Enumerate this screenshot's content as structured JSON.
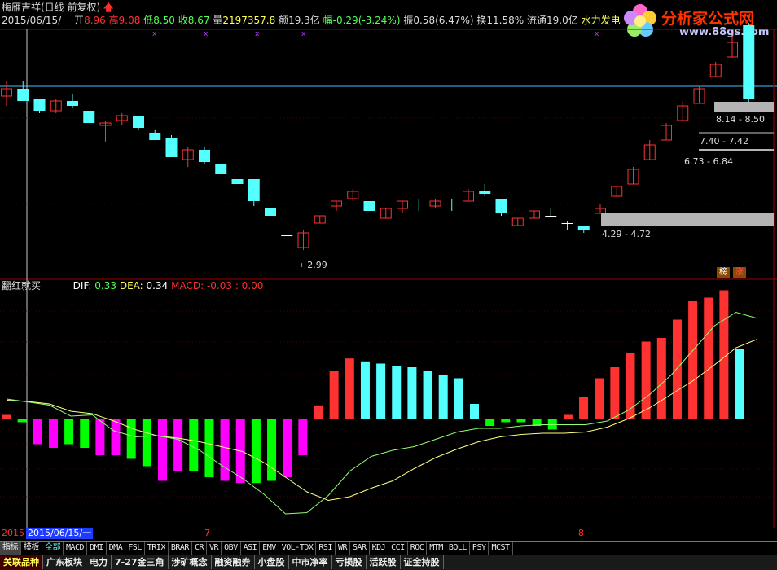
{
  "header": {
    "title": "梅雁吉祥(日线 前复权)",
    "date": "2015/06/15/一",
    "open_label": "开",
    "open": "8.96",
    "high_label": "高",
    "high": "9.08",
    "low_label": "低",
    "low": "8.50",
    "close_label": "收",
    "close": "8.67",
    "volume_label": "量",
    "volume": "2197357.8",
    "amount_label": "额",
    "amount": "19.3亿",
    "change_label": "幅",
    "change": "-0.29(-3.24%)",
    "amplitude_label": "振",
    "amplitude": "0.58(6.47%)",
    "turnover_label": "换",
    "turnover": "11.58%",
    "float_label": "流通",
    "float": "19.0亿",
    "sector": "水力发电"
  },
  "logo": {
    "name": "分析家公式网",
    "url": "www.88gs.com"
  },
  "price_panel": {
    "low_marker": "2.99",
    "zones": [
      "8.14 - 8.50",
      "7.40 - 7.42",
      "6.73 - 6.84",
      "4.29 - 4.72"
    ],
    "rank_badge": "榜",
    "rise_badge": "涨"
  },
  "indicator": {
    "name": "翻红就买",
    "dif_label": "DIF:",
    "dif": "0.33",
    "dea_label": "DEA:",
    "dea": "0.34",
    "macd_label": "MACD:",
    "macd": "-0.03",
    "extra": ": 0.00"
  },
  "date_axis": {
    "year_stub": "2015",
    "cursor_date": "2015/06/15/一",
    "month_7": "7",
    "month_8": "8"
  },
  "tabs_indicator": [
    "指标",
    "模板",
    "全部",
    "MACD",
    "DMI",
    "DMA",
    "FSL",
    "TRIX",
    "BRAR",
    "CR",
    "VR",
    "OBV",
    "ASI",
    "EMV",
    "VOL-TDX",
    "RSI",
    "WR",
    "SAR",
    "KDJ",
    "CCI",
    "ROC",
    "MTM",
    "BOLL",
    "PSY",
    "MCST"
  ],
  "tabs_sector": [
    "关联品种",
    "广东板块",
    "电力",
    "7-27金三角",
    "涉矿概念",
    "融资融券",
    "小盘股",
    "中市净率",
    "亏损股",
    "活跃股",
    "证金持股"
  ],
  "colors": {
    "up": "#ff3232",
    "down": "#54ffff",
    "dif": "#ffffff",
    "dea": "#ffff00",
    "macd_neg_a": "#00ff00",
    "macd_neg_b": "#ff00ff"
  },
  "chart_data": {
    "type": "candlestick",
    "candles": [
      {
        "o": 4.0,
        "h": 4.6,
        "l": 3.6,
        "c": 4.3
      },
      {
        "o": 4.3,
        "h": 4.6,
        "l": 4.0,
        "c": 3.8
      },
      {
        "o": 3.9,
        "h": 3.9,
        "l": 3.3,
        "c": 3.4
      },
      {
        "o": 3.4,
        "h": 3.9,
        "l": 3.3,
        "c": 3.8
      },
      {
        "o": 3.8,
        "h": 4.1,
        "l": 3.5,
        "c": 3.6
      },
      {
        "o": 3.4,
        "h": 3.4,
        "l": 2.9,
        "c": 2.9
      },
      {
        "o": 2.8,
        "h": 3.0,
        "l": 2.1,
        "c": 2.9
      },
      {
        "o": 3.0,
        "h": 3.3,
        "l": 2.8,
        "c": 3.2
      },
      {
        "o": 3.2,
        "h": 3.2,
        "l": 2.6,
        "c": 2.7
      },
      {
        "o": 2.5,
        "h": 2.6,
        "l": 2.2,
        "c": 2.2
      },
      {
        "o": 2.3,
        "h": 2.4,
        "l": 1.5,
        "c": 1.5
      },
      {
        "o": 1.4,
        "h": 1.9,
        "l": 1.1,
        "c": 1.8
      },
      {
        "o": 1.8,
        "h": 1.9,
        "l": 1.2,
        "c": 1.3
      },
      {
        "o": 1.2,
        "h": 1.2,
        "l": 0.8,
        "c": 0.8
      },
      {
        "o": 0.6,
        "h": 0.6,
        "l": 0.4,
        "c": 0.4
      },
      {
        "o": 0.6,
        "h": 0.6,
        "l": -0.5,
        "c": -0.3
      },
      {
        "o": -0.6,
        "h": -0.6,
        "l": -0.9,
        "c": -0.9
      },
      {
        "o": -1.7,
        "h": -1.7,
        "l": -1.7,
        "c": -1.7
      },
      {
        "o": -2.2,
        "h": -1.5,
        "l": -2.3,
        "c": -1.6
      },
      {
        "o": -1.2,
        "h": -0.9,
        "l": -1.2,
        "c": -0.9
      },
      {
        "o": -0.5,
        "h": -0.3,
        "l": -0.7,
        "c": -0.3
      },
      {
        "o": -0.2,
        "h": 0.2,
        "l": -0.3,
        "c": 0.1
      },
      {
        "o": -0.3,
        "h": -0.3,
        "l": -0.7,
        "c": -0.7
      },
      {
        "o": -1.0,
        "h": -0.6,
        "l": -1.0,
        "c": -0.6
      },
      {
        "o": -0.6,
        "h": -0.3,
        "l": -0.8,
        "c": -0.3
      },
      {
        "o": -0.4,
        "h": -0.2,
        "l": -0.7,
        "c": -0.4
      },
      {
        "o": -0.5,
        "h": -0.2,
        "l": -0.6,
        "c": -0.3
      },
      {
        "o": -0.4,
        "h": -0.2,
        "l": -0.7,
        "c": -0.4
      },
      {
        "o": -0.3,
        "h": 0.2,
        "l": -0.3,
        "c": 0.1
      },
      {
        "o": 0.1,
        "h": 0.4,
        "l": -0.1,
        "c": 0.0
      },
      {
        "o": -0.2,
        "h": -0.2,
        "l": -0.9,
        "c": -0.8
      },
      {
        "o": -1.3,
        "h": -1.0,
        "l": -1.3,
        "c": -1.0
      },
      {
        "o": -1.0,
        "h": -0.7,
        "l": -1.0,
        "c": -0.7
      },
      {
        "o": -0.9,
        "h": -0.6,
        "l": -0.9,
        "c": -0.9
      },
      {
        "o": -1.2,
        "h": -1.1,
        "l": -1.5,
        "c": -1.2
      },
      {
        "o": -1.3,
        "h": -1.3,
        "l": -1.6,
        "c": -1.5
      },
      {
        "o": -0.8,
        "h": -0.4,
        "l": -0.8,
        "c": -0.6
      },
      {
        "o": -0.1,
        "h": 0.3,
        "l": -0.1,
        "c": 0.3
      },
      {
        "o": 0.4,
        "h": 1.1,
        "l": 0.4,
        "c": 1.0
      },
      {
        "o": 1.4,
        "h": 2.2,
        "l": 1.4,
        "c": 2.0
      },
      {
        "o": 2.2,
        "h": 2.9,
        "l": 2.2,
        "c": 2.8
      },
      {
        "o": 3.0,
        "h": 3.8,
        "l": 3.0,
        "c": 3.6
      },
      {
        "o": 3.7,
        "h": 4.4,
        "l": 3.7,
        "c": 4.3
      },
      {
        "o": 4.8,
        "h": 5.4,
        "l": 4.8,
        "c": 5.3
      },
      {
        "o": 5.6,
        "h": 6.5,
        "l": 5.6,
        "c": 6.2
      },
      {
        "o": 6.9,
        "h": 7.0,
        "l": 3.6,
        "c": 3.9
      }
    ],
    "macd_hist": [
      0.05,
      -0.05,
      -0.35,
      -0.4,
      -0.35,
      -0.4,
      -0.5,
      -0.5,
      -0.55,
      -0.65,
      -0.85,
      -0.72,
      -0.72,
      -0.8,
      -0.85,
      -0.88,
      -0.88,
      -0.85,
      -0.8,
      -0.5,
      0.18,
      0.65,
      0.82,
      0.78,
      0.75,
      0.72,
      0.7,
      0.65,
      0.6,
      0.55,
      0.2,
      -0.1,
      -0.05,
      -0.05,
      -0.1,
      -0.15,
      0.05,
      0.3,
      0.55,
      0.7,
      0.9,
      1.05,
      1.1,
      1.35,
      1.6,
      1.65,
      1.75,
      0.95
    ],
    "dif": [
      0.8,
      0.68,
      0.55,
      0.1,
      0.15,
      -0.5,
      -0.75,
      -0.7,
      -0.85,
      -1.3,
      -1.9,
      -2.45,
      -3.1,
      -3.9,
      -3.85,
      -3.15,
      -2.15,
      -1.55,
      -1.3,
      -1.15,
      -0.85,
      -0.55,
      -0.4,
      -0.4,
      -0.3,
      -0.25,
      -0.25,
      -0.25,
      -0.1,
      0.35,
      1.0,
      1.8,
      2.8,
      3.8,
      4.35,
      4.1
    ],
    "dea": [
      0.75,
      0.7,
      0.6,
      0.3,
      0.2,
      -0.1,
      -0.45,
      -0.7,
      -0.8,
      -0.95,
      -1.15,
      -1.35,
      -1.8,
      -2.4,
      -3.0,
      -3.35,
      -3.2,
      -2.85,
      -2.55,
      -2.05,
      -1.6,
      -1.25,
      -0.95,
      -0.75,
      -0.65,
      -0.6,
      -0.6,
      -0.55,
      -0.35,
      0.0,
      0.45,
      1.0,
      1.55,
      2.2,
      2.9,
      3.25
    ]
  }
}
